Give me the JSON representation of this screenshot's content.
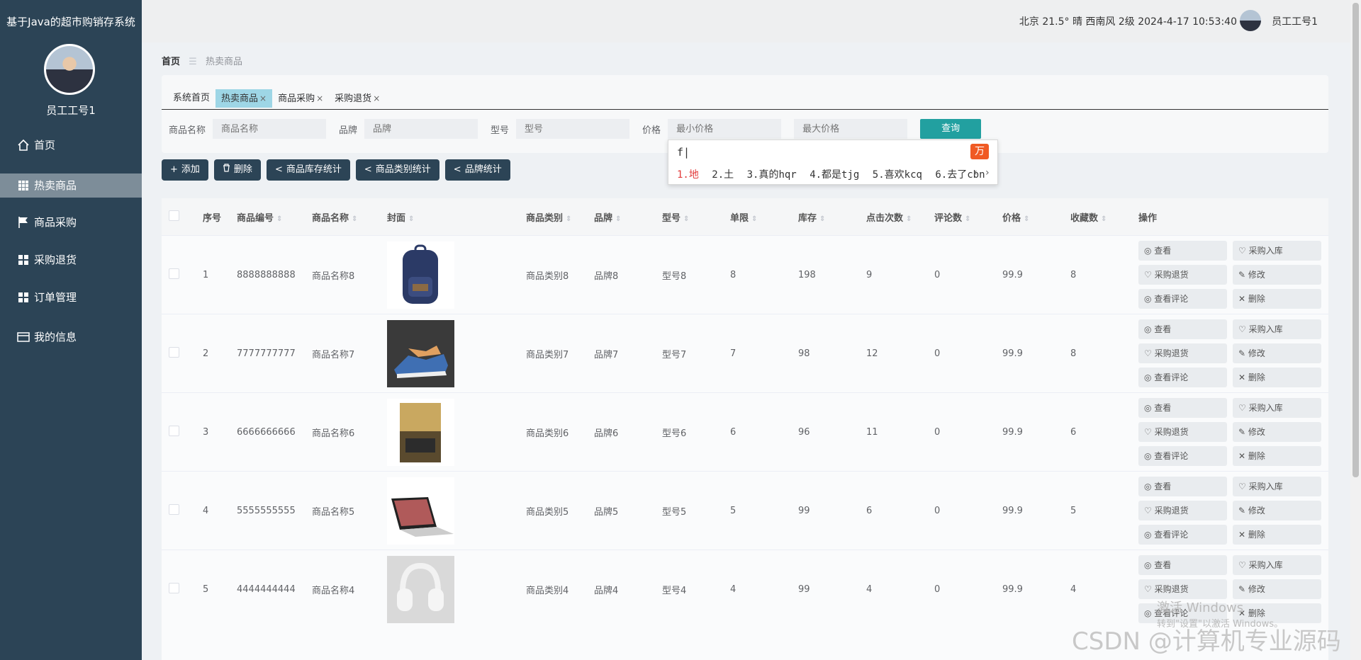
{
  "app": {
    "title": "基于Java的超市购销存系统",
    "username": "员工工号1"
  },
  "sidebar": {
    "items": [
      {
        "label": "首页",
        "icon": "home-icon"
      },
      {
        "label": "热卖商品",
        "icon": "grid-icon",
        "active": true
      },
      {
        "label": "商品采购",
        "icon": "flag-icon"
      },
      {
        "label": "采购退货",
        "icon": "grid-icon"
      },
      {
        "label": "订单管理",
        "icon": "grid-icon"
      },
      {
        "label": "我的信息",
        "icon": "card-icon"
      }
    ]
  },
  "topbar": {
    "weather": "北京 21.5° 晴 西南风 2级 2024-4-17 10:53:40",
    "user": "员工工号1"
  },
  "breadcrumb": {
    "home": "首页",
    "sep": "☰",
    "current": "热卖商品"
  },
  "tabs": [
    {
      "label": "系统首页",
      "closable": false
    },
    {
      "label": "热卖商品",
      "closable": true,
      "active": true
    },
    {
      "label": "商品采购",
      "closable": true
    },
    {
      "label": "采购退货",
      "closable": true
    }
  ],
  "filters": {
    "name_label": "商品名称",
    "name_placeholder": "商品名称",
    "brand_label": "品牌",
    "brand_placeholder": "品牌",
    "model_label": "型号",
    "model_placeholder": "型号",
    "price_label": "价格",
    "min_placeholder": "最小价格",
    "max_placeholder": "最大价格",
    "search": "查询"
  },
  "ime": {
    "input": "f|",
    "logo": "万",
    "candidates": [
      "1.地",
      "2.土",
      "3.真的hqr",
      "4.都是tjg",
      "5.喜欢kcq",
      "6.去了cbn"
    ],
    "nav": "‹ ›"
  },
  "actions": {
    "add": "添加",
    "delete": "删除",
    "stock_stats": "商品库存统计",
    "category_stats": "商品类别统计",
    "brand_stats": "品牌统计"
  },
  "table": {
    "headers": [
      "序号",
      "商品编号",
      "商品名称",
      "封面",
      "商品类别",
      "品牌",
      "型号",
      "单限",
      "库存",
      "点击次数",
      "评论数",
      "价格",
      "收藏数",
      "操作"
    ],
    "ops": {
      "view": "查看",
      "purchase": "采购入库",
      "return": "采购退货",
      "edit": "修改",
      "comments": "查看评论",
      "remove": "删除"
    },
    "rows": [
      {
        "idx": "1",
        "code": "8888888888",
        "name": "商品名称8",
        "cover": "backpack",
        "category": "商品类别8",
        "brand": "品牌8",
        "model": "型号8",
        "limit": "8",
        "stock": "198",
        "clicks": "9",
        "comments": "0",
        "price": "99.9",
        "favs": "8"
      },
      {
        "idx": "2",
        "code": "7777777777",
        "name": "商品名称7",
        "cover": "sneaker",
        "category": "商品类别7",
        "brand": "品牌7",
        "model": "型号7",
        "limit": "7",
        "stock": "98",
        "clicks": "12",
        "comments": "0",
        "price": "99.9",
        "favs": "8"
      },
      {
        "idx": "3",
        "code": "6666666666",
        "name": "商品名称6",
        "cover": "book",
        "category": "商品类别6",
        "brand": "品牌6",
        "model": "型号6",
        "limit": "6",
        "stock": "96",
        "clicks": "11",
        "comments": "0",
        "price": "99.9",
        "favs": "6"
      },
      {
        "idx": "4",
        "code": "5555555555",
        "name": "商品名称5",
        "cover": "laptop",
        "category": "商品类别5",
        "brand": "品牌5",
        "model": "型号5",
        "limit": "5",
        "stock": "99",
        "clicks": "6",
        "comments": "0",
        "price": "99.9",
        "favs": "5"
      },
      {
        "idx": "5",
        "code": "4444444444",
        "name": "商品名称4",
        "cover": "headphones",
        "category": "商品类别4",
        "brand": "品牌4",
        "model": "型号4",
        "limit": "4",
        "stock": "99",
        "clicks": "4",
        "comments": "0",
        "price": "99.9",
        "favs": "4"
      }
    ]
  },
  "watermarks": {
    "windows1": "激活 Windows",
    "windows2": "转到\"设置\"以激活 Windows。",
    "csdn": "CSDN @计算机专业源码"
  }
}
